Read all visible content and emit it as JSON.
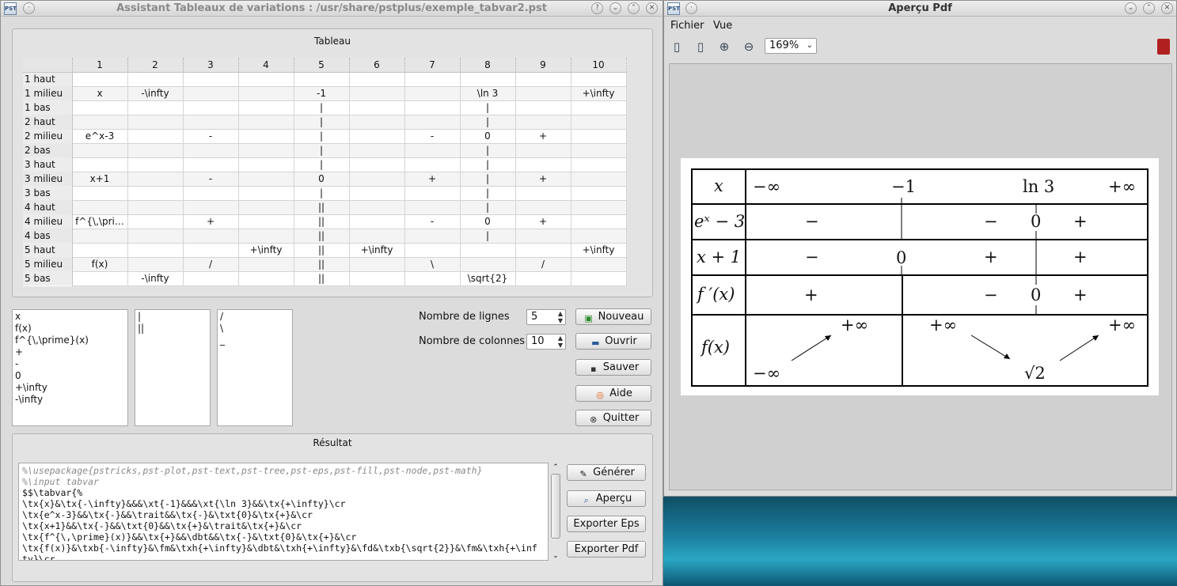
{
  "left_window": {
    "title": "Assistant Tableaux de variations : /usr/share/pstplus/exemple_tabvar2.pst",
    "app_icon": "pst-app-icon",
    "tableau_label": "Tableau",
    "column_headers": [
      "1",
      "2",
      "3",
      "4",
      "5",
      "6",
      "7",
      "8",
      "9",
      "10"
    ],
    "rows": [
      {
        "label": "1 haut",
        "cells": [
          "",
          "",
          "",
          "",
          "",
          "",
          "",
          "",
          "",
          ""
        ]
      },
      {
        "label": "1 milieu",
        "cells": [
          "x",
          "-\\infty",
          "",
          "",
          "-1",
          "",
          "",
          "\\ln 3",
          "",
          "+\\infty"
        ]
      },
      {
        "label": "1 bas",
        "cells": [
          "",
          "",
          "",
          "",
          "|",
          "",
          "",
          "|",
          "",
          ""
        ]
      },
      {
        "label": "2 haut",
        "cells": [
          "",
          "",
          "",
          "",
          "|",
          "",
          "",
          "|",
          "",
          ""
        ]
      },
      {
        "label": "2 milieu",
        "cells": [
          "e^x-3",
          "",
          "-",
          "",
          "|",
          "",
          "-",
          "0",
          "+",
          ""
        ]
      },
      {
        "label": "2 bas",
        "cells": [
          "",
          "",
          "",
          "",
          "|",
          "",
          "",
          "|",
          "",
          ""
        ]
      },
      {
        "label": "3 haut",
        "cells": [
          "",
          "",
          "",
          "",
          "|",
          "",
          "",
          "|",
          "",
          ""
        ]
      },
      {
        "label": "3 milieu",
        "cells": [
          "x+1",
          "",
          "-",
          "",
          "0",
          "",
          "+",
          "|",
          "+",
          ""
        ]
      },
      {
        "label": "3 bas",
        "cells": [
          "",
          "",
          "",
          "",
          "|",
          "",
          "",
          "|",
          "",
          ""
        ]
      },
      {
        "label": "4 haut",
        "cells": [
          "",
          "",
          "",
          "",
          "||",
          "",
          "",
          "|",
          "",
          ""
        ]
      },
      {
        "label": "4 milieu",
        "cells": [
          "f^{\\,\\pri…",
          "",
          "+",
          "",
          "||",
          "",
          "-",
          "0",
          "+",
          ""
        ]
      },
      {
        "label": "4 bas",
        "cells": [
          "",
          "",
          "",
          "",
          "||",
          "",
          "",
          "|",
          "",
          ""
        ]
      },
      {
        "label": "5 haut",
        "cells": [
          "",
          "",
          "",
          "+\\infty",
          "||",
          "+\\infty",
          "",
          "",
          "",
          "+\\infty"
        ]
      },
      {
        "label": "5 milieu",
        "cells": [
          "f(x)",
          "",
          "/",
          "",
          "||",
          "",
          "\\",
          "",
          "/",
          ""
        ]
      },
      {
        "label": "5 bas",
        "cells": [
          "",
          "-\\infty",
          "",
          "",
          "||",
          "",
          "",
          "\\sqrt{2}",
          "",
          ""
        ]
      }
    ],
    "list1": [
      "x",
      "f(x)",
      "f^{\\,\\prime}(x)",
      "+",
      "-",
      "0",
      "+\\infty",
      "-\\infty"
    ],
    "list2": [
      "|",
      "||"
    ],
    "list3": [
      "/",
      "\\",
      "_"
    ],
    "nb_lignes_label": "Nombre de lignes",
    "nb_lignes_value": "5",
    "nb_colonnes_label": "Nombre de colonnes",
    "nb_colonnes_value": "10",
    "buttons": {
      "nouveau": "Nouveau",
      "ouvrir": "Ouvrir",
      "sauver": "Sauver",
      "aide": "Aide",
      "quitter": "Quitter"
    },
    "resultat_label": "Résultat",
    "code_comments": [
      "%\\usepackage{pstricks,pst-plot,pst-text,pst-tree,pst-eps,pst-fill,pst-node,pst-math}",
      "%\\input tabvar"
    ],
    "code_lines": [
      "$$\\tabvar{%",
      "\\tx{x}&\\tx{-\\infty}&&&\\xt{-1}&&&\\xt{\\ln 3}&&\\tx{+\\infty}\\cr",
      "\\tx{e^x-3}&&\\tx{-}&&\\trait&&\\tx{-}&\\txt{0}&\\tx{+}&\\cr",
      "\\tx{x+1}&&\\tx{-}&&\\txt{0}&&\\tx{+}&\\trait&\\tx{+}&\\cr",
      "\\tx{f^{\\,\\prime}(x)}&&\\tx{+}&&\\dbt&&\\tx{-}&\\txt{0}&\\tx{+}&\\cr",
      "\\tx{f(x)}&\\txb{-\\infty}&\\fm&\\txh{+\\infty}&\\dbt&\\txh{+\\infty}&\\fd&\\txb{\\sqrt{2}}&\\fm&\\txh{+\\inf",
      "ty}\\cr"
    ],
    "result_buttons": {
      "generer": "Générer",
      "apercu": "Aperçu",
      "exporter_eps": "Exporter Eps",
      "exporter_pdf": "Exporter Pdf"
    }
  },
  "right_window": {
    "title": "Aperçu Pdf",
    "menu": [
      "Fichier",
      "Vue"
    ],
    "zoom": "169%",
    "preview": {
      "row1": {
        "label": "x",
        "values": [
          "−∞",
          "−1",
          "ln 3",
          "+∞"
        ]
      },
      "row2": {
        "label": "eˣ − 3",
        "signs": [
          "−",
          "−",
          "0",
          "+"
        ]
      },
      "row3": {
        "label": "x + 1",
        "signs": [
          "−",
          "0",
          "+",
          "+"
        ]
      },
      "row4": {
        "label": "f ′(x)",
        "signs": [
          "+",
          "−",
          "0",
          "+"
        ]
      },
      "row5": {
        "label": "f(x)",
        "values": [
          "+∞",
          "+∞",
          "+∞",
          "−∞",
          "√2"
        ]
      }
    }
  }
}
